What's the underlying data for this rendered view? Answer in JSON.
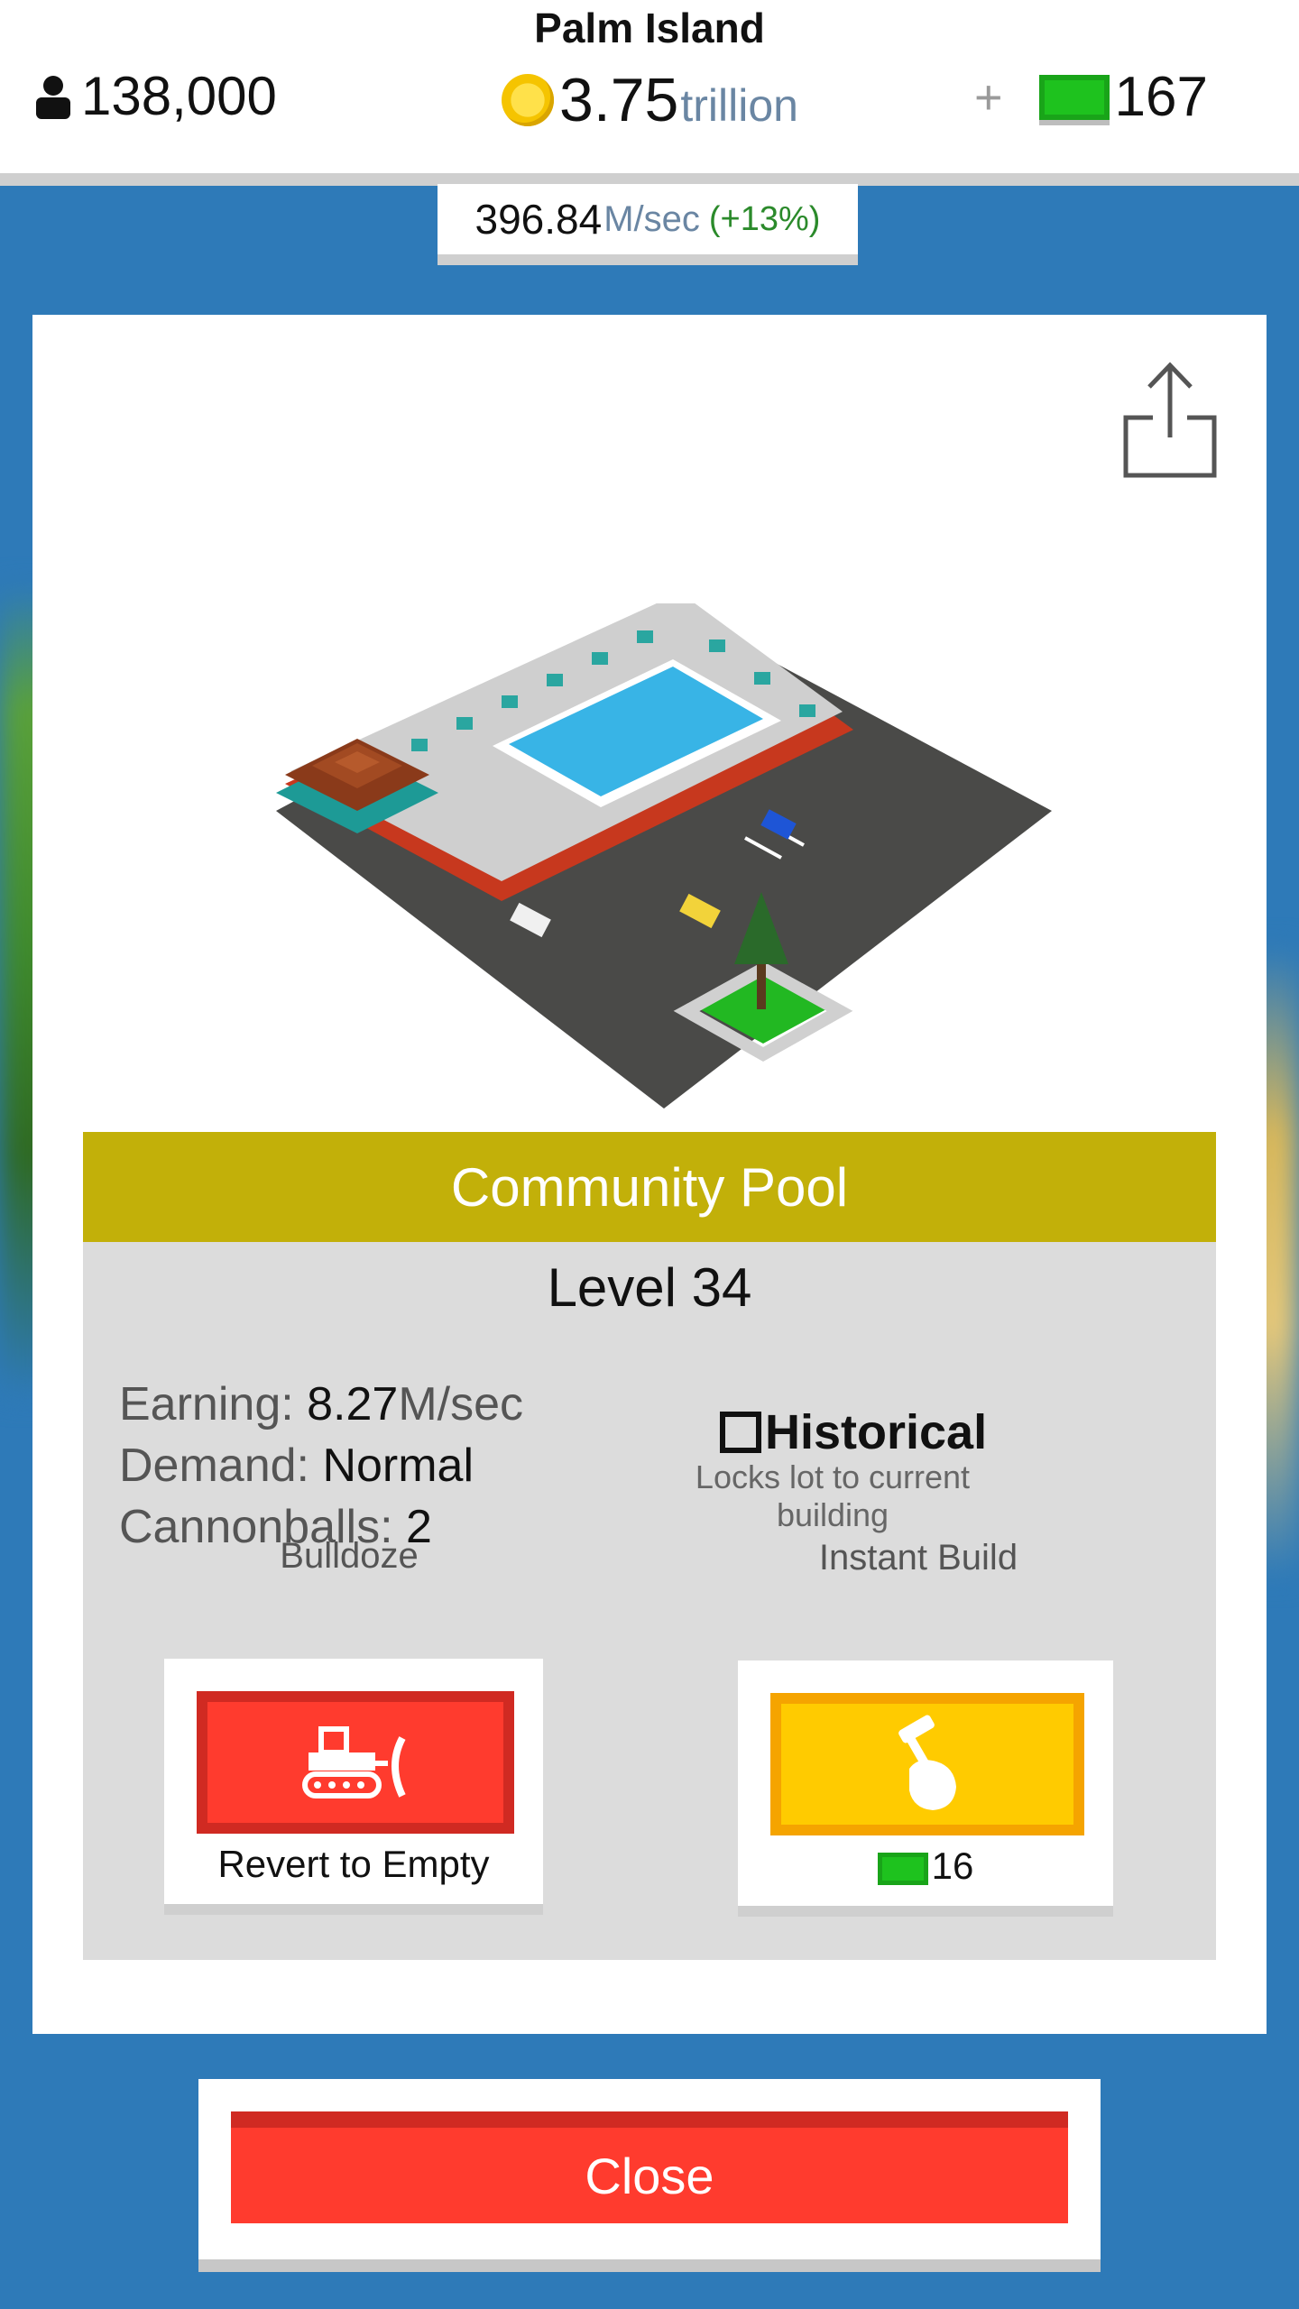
{
  "hud": {
    "island_name": "Palm Island",
    "population": "138,000",
    "money_value": "3.75",
    "money_unit": "trillion",
    "gems_plus": "+",
    "gems": "167",
    "rate_value": "396.84",
    "rate_unit": "M/sec",
    "rate_bonus": "(+13%)"
  },
  "building": {
    "name": "Community Pool",
    "level": "Level 34",
    "earning_label": "Earning:",
    "earning_value": "8.27",
    "earning_unit": "M/sec",
    "demand_label": "Demand:",
    "demand_value": "Normal",
    "cannonballs_label": "Cannonballs:",
    "cannonballs_value": "2"
  },
  "historical": {
    "label": "Historical",
    "description": "Locks lot to current building",
    "checked": false
  },
  "actions": {
    "bulldoze_label": "Bulldoze",
    "bulldoze_caption": "Revert to Empty",
    "instant_label": "Instant Build",
    "instant_cost": "16"
  },
  "footer": {
    "close_label": "Close"
  },
  "colors": {
    "background": "#2e7ab8",
    "name_bar": "#c2b009",
    "bulldoze": "#ff3b2e",
    "instant": "#ffcb00",
    "gem": "#1ec21e"
  }
}
